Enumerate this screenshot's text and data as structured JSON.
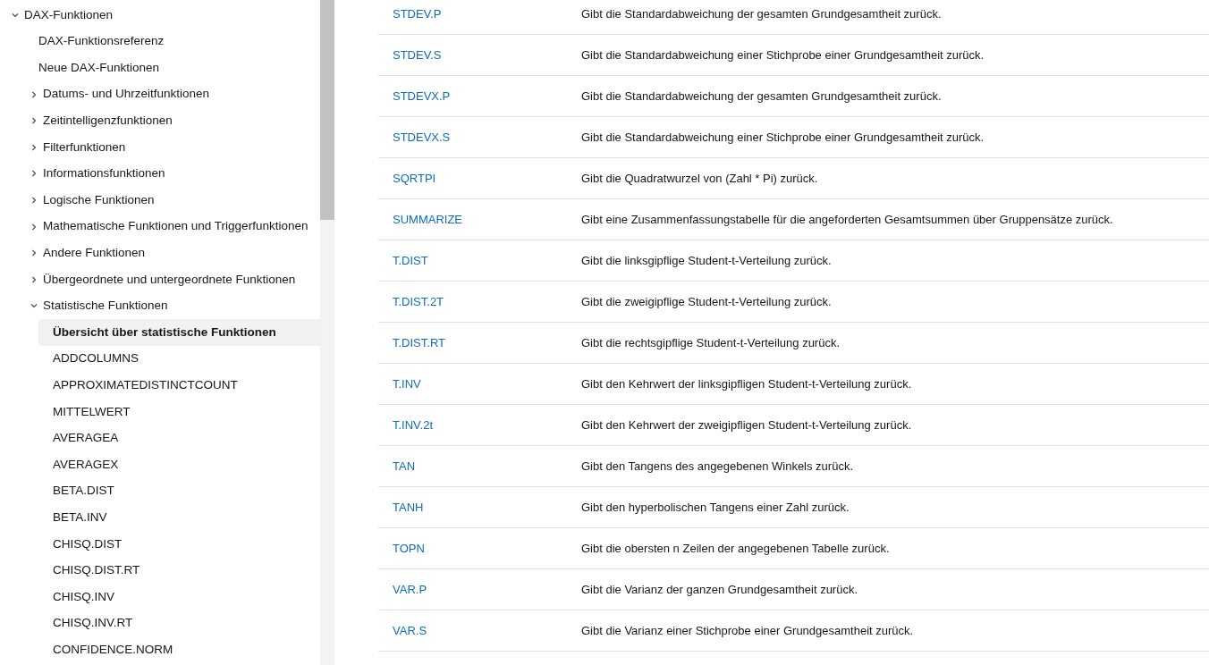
{
  "sidebar": {
    "items": [
      {
        "kind": "folder",
        "label": "DAX-Funktionen",
        "expanded": true,
        "selected": false,
        "children": [
          {
            "kind": "page",
            "label": "DAX-Funktionsreferenz",
            "selected": false
          },
          {
            "kind": "page",
            "label": "Neue DAX-Funktionen",
            "selected": false
          },
          {
            "kind": "folder",
            "label": "Datums- und Uhrzeitfunktionen",
            "expanded": false,
            "selected": false
          },
          {
            "kind": "folder",
            "label": "Zeitintelligenzfunktionen",
            "expanded": false,
            "selected": false
          },
          {
            "kind": "folder",
            "label": "Filterfunktionen",
            "expanded": false,
            "selected": false
          },
          {
            "kind": "folder",
            "label": "Informationsfunktionen",
            "expanded": false,
            "selected": false
          },
          {
            "kind": "folder",
            "label": "Logische Funktionen",
            "expanded": false,
            "selected": false
          },
          {
            "kind": "folder",
            "label": "Mathematische Funktionen und Triggerfunktionen",
            "expanded": false,
            "selected": false
          },
          {
            "kind": "folder",
            "label": "Andere Funktionen",
            "expanded": false,
            "selected": false
          },
          {
            "kind": "folder",
            "label": "Übergeordnete und untergeordnete Funktionen",
            "expanded": false,
            "selected": false
          },
          {
            "kind": "folder",
            "label": "Statistische Funktionen",
            "expanded": true,
            "selected": false,
            "children": [
              {
                "kind": "page",
                "label": "Übersicht über statistische Funktionen",
                "selected": true
              },
              {
                "kind": "page",
                "label": "ADDCOLUMNS",
                "selected": false
              },
              {
                "kind": "page",
                "label": "APPROXIMATEDISTINCTCOUNT",
                "selected": false
              },
              {
                "kind": "page",
                "label": "MITTELWERT",
                "selected": false
              },
              {
                "kind": "page",
                "label": "AVERAGEA",
                "selected": false
              },
              {
                "kind": "page",
                "label": "AVERAGEX",
                "selected": false
              },
              {
                "kind": "page",
                "label": "BETA.DIST",
                "selected": false
              },
              {
                "kind": "page",
                "label": "BETA.INV",
                "selected": false
              },
              {
                "kind": "page",
                "label": "CHISQ.DIST",
                "selected": false
              },
              {
                "kind": "page",
                "label": "CHISQ.DIST.RT",
                "selected": false
              },
              {
                "kind": "page",
                "label": "CHISQ.INV",
                "selected": false
              },
              {
                "kind": "page",
                "label": "CHISQ.INV.RT",
                "selected": false
              },
              {
                "kind": "page",
                "label": "CONFIDENCE.NORM",
                "selected": false
              }
            ]
          }
        ]
      }
    ]
  },
  "table": {
    "rows": [
      {
        "function": "STDEV.P",
        "description": "Gibt die Standardabweichung der gesamten Grundgesamtheit zurück."
      },
      {
        "function": "STDEV.S",
        "description": "Gibt die Standardabweichung einer Stichprobe einer Grundgesamtheit zurück."
      },
      {
        "function": "STDEVX.P",
        "description": "Gibt die Standardabweichung der gesamten Grundgesamtheit zurück."
      },
      {
        "function": "STDEVX.S",
        "description": "Gibt die Standardabweichung einer Stichprobe einer Grundgesamtheit zurück."
      },
      {
        "function": "SQRTPI",
        "description": "Gibt die Quadratwurzel von (Zahl * Pi) zurück."
      },
      {
        "function": "SUMMARIZE",
        "description": "Gibt eine Zusammenfassungstabelle für die angeforderten Gesamtsummen über Gruppensätze zurück."
      },
      {
        "function": "T.DIST",
        "description": "Gibt die linksgipflige Student-t-Verteilung zurück."
      },
      {
        "function": "T.DIST.2T",
        "description": "Gibt die zweigipflige Student-t-Verteilung zurück."
      },
      {
        "function": "T.DIST.RT",
        "description": "Gibt die rechtsgipflige Student-t-Verteilung zurück."
      },
      {
        "function": "T.INV",
        "description": "Gibt den Kehrwert der linksgipfligen Student-t-Verteilung zurück."
      },
      {
        "function": "T.INV.2t",
        "description": "Gibt den Kehrwert der zweigipfligen Student-t-Verteilung zurück."
      },
      {
        "function": "TAN",
        "description": "Gibt den Tangens des angegebenen Winkels zurück."
      },
      {
        "function": "TANH",
        "description": "Gibt den hyperbolischen Tangens einer Zahl zurück."
      },
      {
        "function": "TOPN",
        "description": "Gibt die obersten n Zeilen der angegebenen Tabelle zurück."
      },
      {
        "function": "VAR.P",
        "description": "Gibt die Varianz der ganzen Grundgesamtheit zurück."
      },
      {
        "function": "VAR.S",
        "description": "Gibt die Varianz einer Stichprobe einer Grundgesamtheit zurück."
      }
    ]
  }
}
